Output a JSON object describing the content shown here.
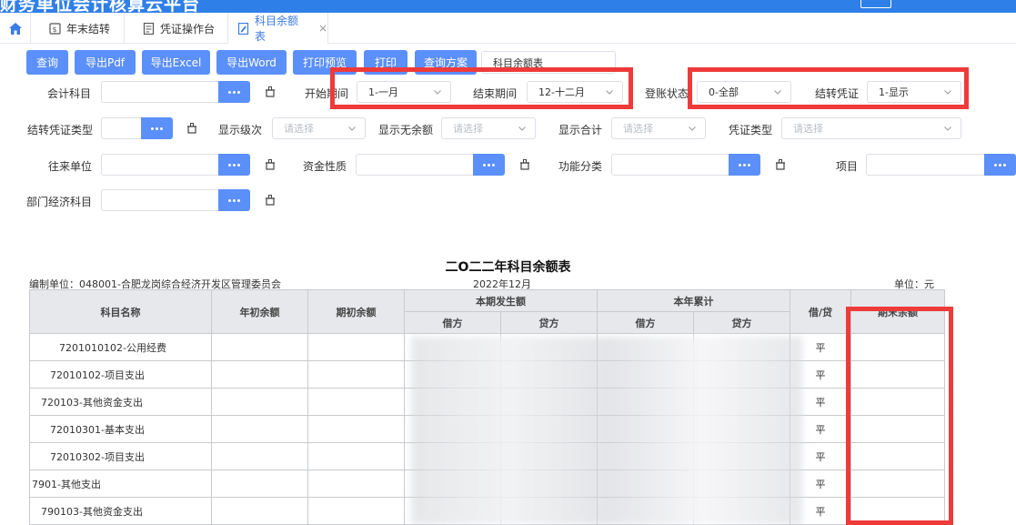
{
  "app": {
    "title": "财务单位会计核算云平台"
  },
  "tabs": [
    {
      "label": "年末结转"
    },
    {
      "label": "凭证操作台"
    },
    {
      "label": "科目余额表",
      "close": "×"
    }
  ],
  "toolbar": {
    "buttons": [
      "查询",
      "导出Pdf",
      "导出Excel",
      "导出Word",
      "打印预览",
      "打印",
      "查询方案"
    ],
    "scheme_select": "科目余额表"
  },
  "filters": {
    "account_label": "会计科目",
    "start_label": "开始期间",
    "start_value": "1-一月",
    "end_label": "结束期间",
    "end_value": "12-十二月",
    "posting_label": "登账状态",
    "posting_value": "0-全部",
    "carry_label": "结转凭证",
    "carry_value": "1-显示",
    "carry_type_label": "结转凭证类型",
    "level_label": "显示级次",
    "level_placeholder": "请选择",
    "no_balance_label": "显示无余额",
    "no_balance_placeholder": "请选择",
    "total_label": "显示合计",
    "total_placeholder": "请选择",
    "voucher_type_label": "凭证类型",
    "voucher_type_placeholder": "请选择",
    "partner_label": "往来单位",
    "fund_label": "资金性质",
    "function_label": "功能分类",
    "project_label": "项目",
    "dept_label": "部门经济科目"
  },
  "report": {
    "title": "二O二二年科目余额表",
    "org": "编制单位：048001-合肥龙岗综合经济开发区管理委员会",
    "period": "2022年12月",
    "unit": "单位：元",
    "headers": {
      "name": "科目名称",
      "year_open": "年初余额",
      "period_open": "期初余额",
      "current": "本期发生额",
      "ytd": "本年累计",
      "debit": "借方",
      "credit": "贷方",
      "direction": "借/贷",
      "closing": "期末余额"
    },
    "rows": [
      {
        "name": "7201010102-公用经费",
        "dir": "平"
      },
      {
        "name": "72010102-项目支出",
        "dir": "平"
      },
      {
        "name": "720103-其他资金支出",
        "dir": "平"
      },
      {
        "name": "72010301-基本支出",
        "dir": "平"
      },
      {
        "name": "72010302-项目支出",
        "dir": "平"
      },
      {
        "name": "7901-其他支出",
        "dir": "平"
      },
      {
        "name": "790103-其他资金支出",
        "dir": "平"
      }
    ]
  },
  "colors": {
    "accent": "#5b8ff9",
    "highlight": "#ee3a3a",
    "header_bg": "#e6e8ec"
  }
}
